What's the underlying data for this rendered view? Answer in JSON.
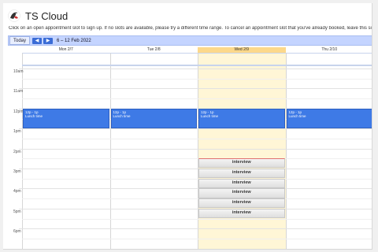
{
  "app": {
    "title": "TS Cloud"
  },
  "instructions": "Click on an open appointment slot to sign up. If no slots are available, please try a different time range. To cancel an appointment slot that you've already booked, leave this sign-up page and",
  "toolbar": {
    "today_label": "Today",
    "prev_icon": "chevron-left-icon",
    "next_icon": "chevron-right-icon",
    "range": "6 – 12 Feb 2022"
  },
  "columns": [
    {
      "label": "Mon 2/7",
      "today": false
    },
    {
      "label": "Tue 2/8",
      "today": false
    },
    {
      "label": "Wed 2/9",
      "today": true
    },
    {
      "label": "Thu 2/10",
      "today": false
    }
  ],
  "time_labels": [
    "10am",
    "11am",
    "12pm",
    "1pm",
    "2pm",
    "3pm",
    "4pm",
    "5pm",
    "6pm"
  ],
  "lunch_events": [
    {
      "time": "12p - 1p",
      "title": "Lunch time"
    },
    {
      "time": "12p - 1p",
      "title": "Lunch time"
    },
    {
      "time": "12p - 1p",
      "title": "Lunch time"
    },
    {
      "time": "12p - 1p",
      "title": "Lunch time"
    }
  ],
  "interview_slots": [
    "interview",
    "interview",
    "interview",
    "interview",
    "interview",
    "interview"
  ],
  "colors": {
    "toolbar": "#c4d4ff",
    "event": "#3e7ae6",
    "today_header": "#fcd88a",
    "today_column": "#fff6d6"
  }
}
